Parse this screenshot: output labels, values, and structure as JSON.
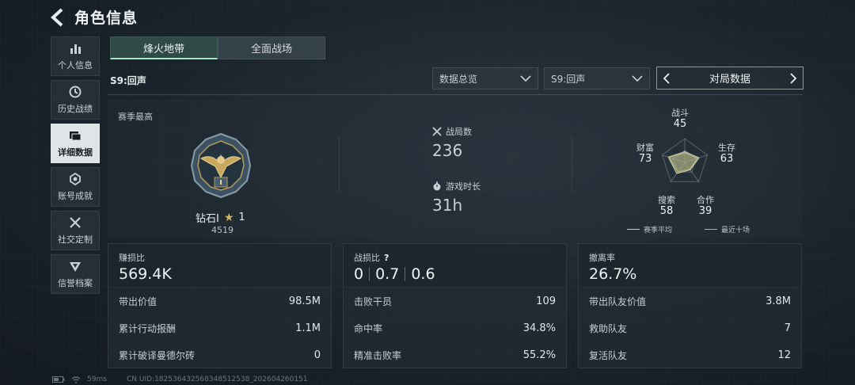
{
  "header": {
    "title": "角色信息"
  },
  "sidebar": {
    "items": [
      {
        "label": "个人信息",
        "icon": "bar-chart-icon"
      },
      {
        "label": "历史战绩",
        "icon": "history-icon"
      },
      {
        "label": "详细数据",
        "icon": "folder-icon",
        "active": true
      },
      {
        "label": "账号成就",
        "icon": "medal-icon"
      },
      {
        "label": "社交定制",
        "icon": "tools-icon"
      },
      {
        "label": "信誉档案",
        "icon": "shield-icon"
      }
    ]
  },
  "tabs": [
    {
      "label": "烽火地带",
      "active": true
    },
    {
      "label": "全面战场",
      "active": false
    }
  ],
  "season": "S9:回声",
  "filters": {
    "category": "数据总览",
    "season": "S9:回声",
    "match_label": "对局数据"
  },
  "overview": {
    "title": "赛季最高",
    "rank": {
      "name": "钻石Ⅰ",
      "stars": "1",
      "score": "4519"
    },
    "matches": {
      "label": "战局数",
      "value": "236"
    },
    "playtime": {
      "label": "游戏时长",
      "value": "31h"
    },
    "radar": {
      "axes": [
        {
          "label": "战斗",
          "value": "45"
        },
        {
          "label": "生存",
          "value": "63"
        },
        {
          "label": "合作",
          "value": "39"
        },
        {
          "label": "搜索",
          "value": "58"
        },
        {
          "label": "财富",
          "value": "73"
        }
      ],
      "season_avg": [
        0.45,
        0.63,
        0.39,
        0.58,
        0.73
      ],
      "recent": [
        0.4,
        0.58,
        0.35,
        0.5,
        0.7
      ],
      "legend": {
        "avg": "赛季平均",
        "recent": "最近十场"
      },
      "colors": {
        "avg": "#c8ced2",
        "recent": "#b6b56c"
      }
    }
  },
  "cards": [
    {
      "title": "赚损比",
      "value": "569.4K",
      "rows": [
        {
          "label": "带出价值",
          "value": "98.5M"
        },
        {
          "label": "累计行动报酬",
          "value": "1.1M"
        },
        {
          "label": "累计破译曼德尔砖",
          "value": "0"
        }
      ]
    },
    {
      "title": "战损比",
      "help": "?",
      "kd": [
        "0",
        "0.7",
        "0.6"
      ],
      "rows": [
        {
          "label": "击败干员",
          "value": "109"
        },
        {
          "label": "命中率",
          "value": "34.8%"
        },
        {
          "label": "精准击败率",
          "value": "55.2%"
        }
      ]
    },
    {
      "title": "撤离率",
      "value": "26.7%",
      "rows": [
        {
          "label": "带出队友价值",
          "value": "3.8M"
        },
        {
          "label": "救助队友",
          "value": "7"
        },
        {
          "label": "复活队友",
          "value": "12"
        }
      ]
    }
  ],
  "footer": {
    "ping": "59ms",
    "uid": "CN UID:182536432568348512538_202604260151"
  }
}
